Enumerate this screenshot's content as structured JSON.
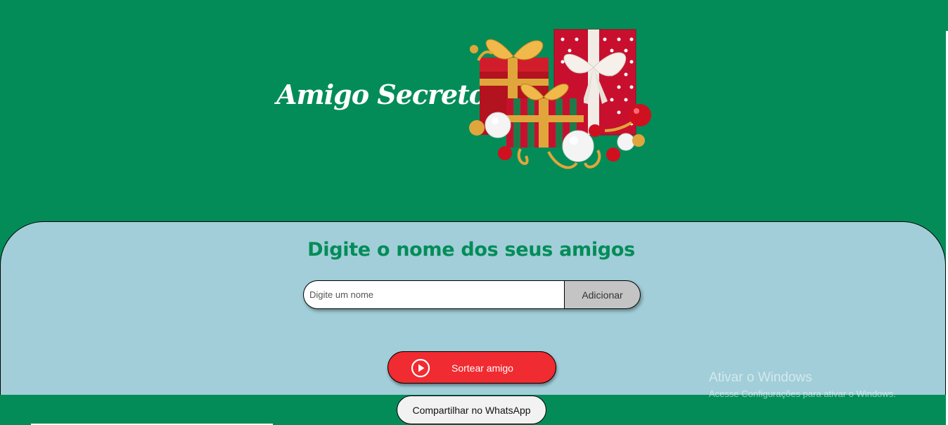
{
  "header": {
    "title": "Amigo Secreto"
  },
  "main": {
    "heading": "Digite o nome dos seus amigos",
    "name_input": {
      "placeholder": "Digite um nome",
      "value": ""
    },
    "add_button_label": "Adicionar",
    "draw_button_label": "Sortear amigo",
    "share_button_label": "Compartilhar no WhatsApp"
  },
  "watermark": {
    "title": "Ativar o Windows",
    "subtitle": "Acesse Configurações para ativar o Windows."
  },
  "colors": {
    "background_green": "#038c58",
    "section_blue": "#a1ced9",
    "heading_green": "#038c58",
    "draw_button_red": "#f02b31",
    "add_button_gray": "#c4c4c4",
    "share_button_bg": "#f2f2f2"
  },
  "icons": {
    "gifts_image": "christmas-gifts-illustration",
    "draw_button_icon": "play-circle-icon"
  }
}
